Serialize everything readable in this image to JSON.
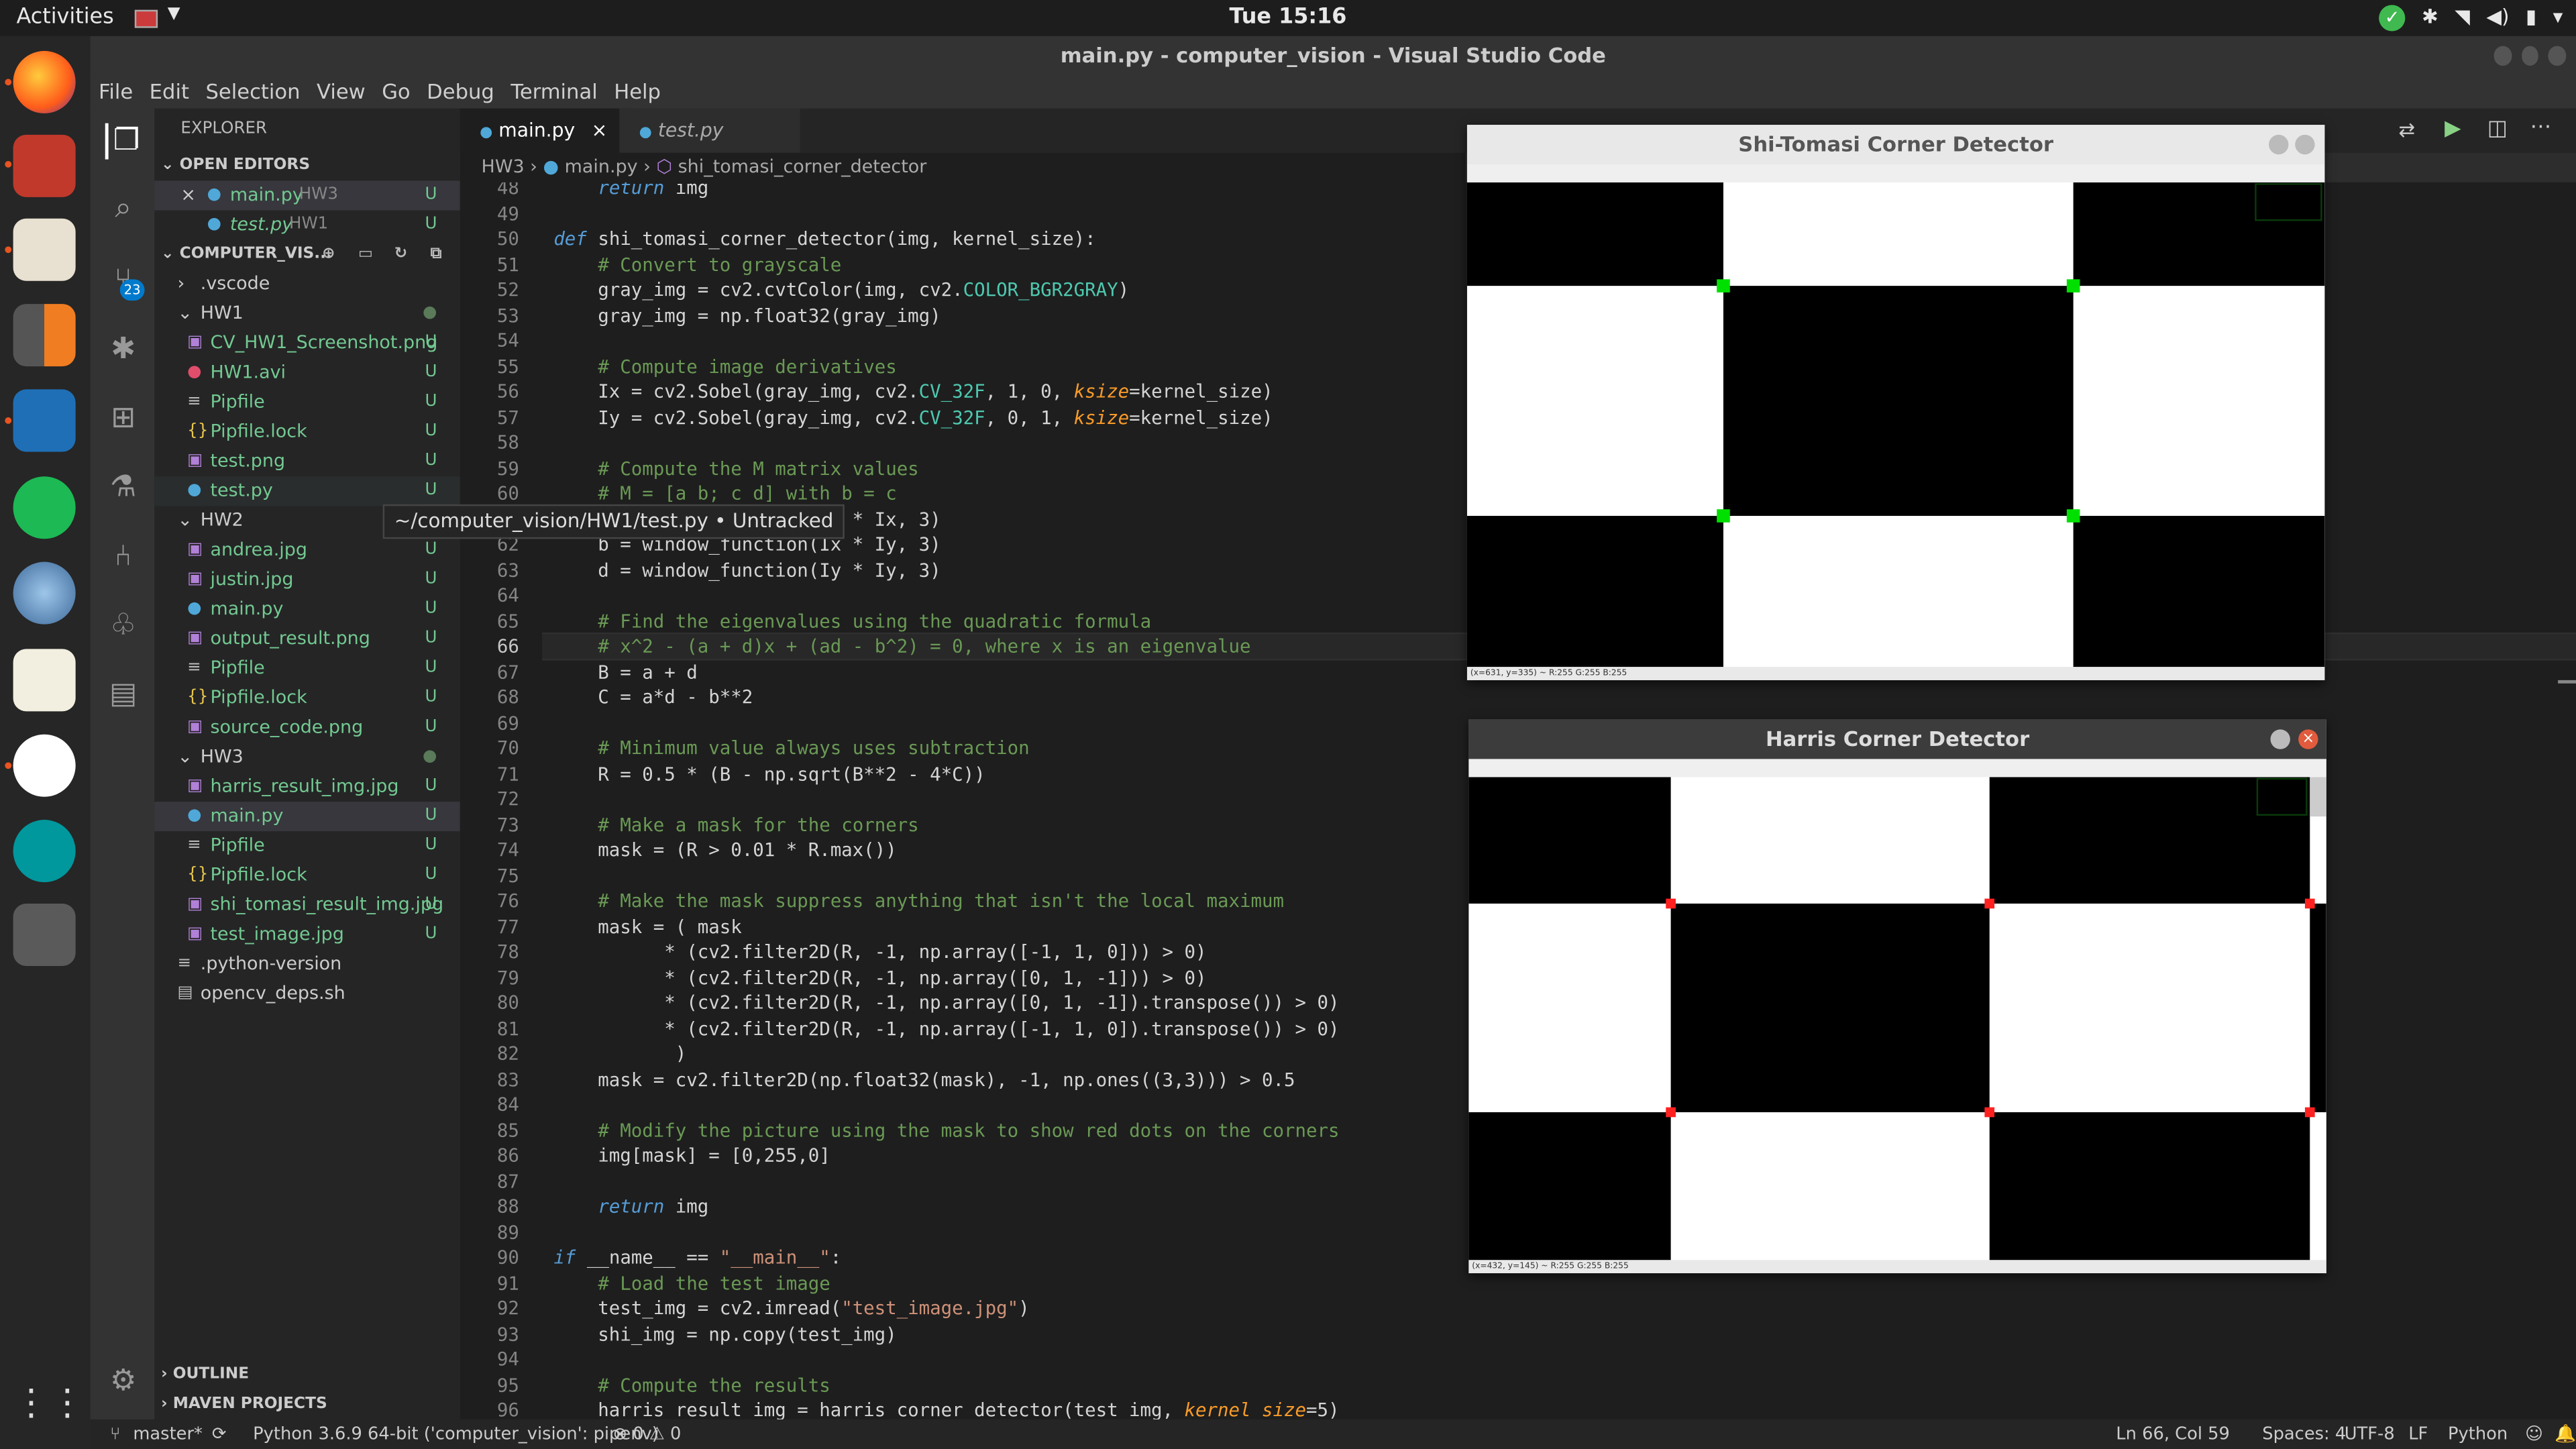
{
  "topbar": {
    "activities": "Activities",
    "clock": "Tue 15:16"
  },
  "window": {
    "title": "main.py - computer_vision - Visual Studio Code"
  },
  "menu": [
    "File",
    "Edit",
    "Selection",
    "View",
    "Go",
    "Debug",
    "Terminal",
    "Help"
  ],
  "activity": {
    "scm_badge": "23"
  },
  "sidebar": {
    "title": "EXPLORER",
    "open_editors": "OPEN EDITORS",
    "oe": [
      {
        "name": "main.py",
        "dir": "HW3",
        "status": "U"
      },
      {
        "name": "test.py",
        "dir": "HW1",
        "status": "U"
      }
    ],
    "folder": "COMPUTER_VIS...",
    "tree": [
      {
        "name": ".vscode",
        "status": ""
      },
      {
        "name": "HW1",
        "status": ""
      },
      {
        "name": "CV_HW1_Screenshot.png",
        "status": "U"
      },
      {
        "name": "HW1.avi",
        "status": "U"
      },
      {
        "name": "Pipfile",
        "status": "U"
      },
      {
        "name": "Pipfile.lock",
        "status": "U"
      },
      {
        "name": "test.png",
        "status": "U"
      },
      {
        "name": "test.py",
        "status": "U"
      },
      {
        "name": "HW2",
        "status": ""
      },
      {
        "name": "andrea.jpg",
        "status": "U"
      },
      {
        "name": "justin.jpg",
        "status": "U"
      },
      {
        "name": "main.py",
        "status": "U"
      },
      {
        "name": "output_result.png",
        "status": "U"
      },
      {
        "name": "Pipfile",
        "status": "U"
      },
      {
        "name": "Pipfile.lock",
        "status": "U"
      },
      {
        "name": "source_code.png",
        "status": "U"
      },
      {
        "name": "HW3",
        "status": ""
      },
      {
        "name": "harris_result_img.jpg",
        "status": "U"
      },
      {
        "name": "main.py",
        "status": "U"
      },
      {
        "name": "Pipfile",
        "status": "U"
      },
      {
        "name": "Pipfile.lock",
        "status": "U"
      },
      {
        "name": "shi_tomasi_result_img.jpg",
        "status": "U"
      },
      {
        "name": "test_image.jpg",
        "status": "U"
      },
      {
        "name": ".python-version",
        "status": ""
      },
      {
        "name": "opencv_deps.sh",
        "status": ""
      }
    ],
    "outline": "OUTLINE",
    "maven": "MAVEN PROJECTS"
  },
  "tabs": [
    {
      "label": "main.py"
    },
    {
      "label": "test.py"
    }
  ],
  "breadcrumb": {
    "folder": "HW3",
    "file": "main.py",
    "symbol": "shi_tomasi_corner_detector"
  },
  "tooltip": "~/computer_vision/HW1/test.py • Untracked",
  "editor": {
    "line_numbers": [
      "48",
      "49",
      "50",
      "51",
      "52",
      "53",
      "54",
      "55",
      "56",
      "57",
      "58",
      "59",
      "60",
      "61",
      "62",
      "63",
      "64",
      "65",
      "66",
      "67",
      "68",
      "69",
      "70",
      "71",
      "72",
      "73",
      "74",
      "75",
      "76",
      "77",
      "78",
      "79",
      "80",
      "81",
      "82",
      "83",
      "84",
      "85",
      "86",
      "87",
      "88",
      "89",
      "90",
      "91",
      "92",
      "93",
      "94",
      "95",
      "96"
    ],
    "lines": [
      "    return img",
      "",
      "def shi_tomasi_corner_detector(img, kernel_size):",
      "    # Convert to grayscale",
      "    gray_img = cv2.cvtColor(img, cv2.COLOR_BGR2GRAY)",
      "    gray_img = np.float32(gray_img)",
      "",
      "    # Compute image derivatives",
      "    Ix = cv2.Sobel(gray_img, cv2.CV_32F, 1, 0, ksize=kernel_size)",
      "    Iy = cv2.Sobel(gray_img, cv2.CV_32F, 0, 1, ksize=kernel_size)",
      "",
      "    # Compute the M matrix values",
      "    # M = [a b; c d] with b = c",
      "    a = window_function(Ix * Ix, 3)",
      "    b = window_function(Ix * Iy, 3)",
      "    d = window_function(Iy * Iy, 3)",
      "",
      "    # Find the eigenvalues using the quadratic formula",
      "    # x^2 - (a + d)x + (ad - b^2) = 0, where x is an eigenvalue",
      "    B = a + d",
      "    C = a*d - b**2",
      "",
      "    # Minimum value always uses subtraction",
      "    R = 0.5 * (B - np.sqrt(B**2 - 4*C))",
      "",
      "    # Make a mask for the corners",
      "    mask = (R > 0.01 * R.max())",
      "",
      "    # Make the mask suppress anything that isn't the local maximum",
      "    mask = ( mask",
      "          * (cv2.filter2D(R, -1, np.array([-1, 1, 0])) > 0)",
      "          * (cv2.filter2D(R, -1, np.array([0, 1, -1])) > 0)",
      "          * (cv2.filter2D(R, -1, np.array([0, 1, -1]).transpose()) > 0)",
      "          * (cv2.filter2D(R, -1, np.array([-1, 1, 0]).transpose()) > 0)",
      "           )",
      "    mask = cv2.filter2D(np.float32(mask), -1, np.ones((3,3))) > 0.5",
      "",
      "    # Modify the picture using the mask to show red dots on the corners",
      "    img[mask] = [0,255,0]",
      "",
      "    return img",
      "",
      "if __name__ == \"__main__\":",
      "    # Load the test image",
      "    test_img = cv2.imread(\"test_image.jpg\")",
      "    shi_img = np.copy(test_img)",
      "",
      "    # Compute the results",
      "    harris_result_img = harris_corner_detector(test_img, kernel_size=5)"
    ]
  },
  "cv_windows": {
    "shi": {
      "title": "Shi-Tomasi Corner Detector",
      "status": "(x=631, y=335) ~ R:255 G:255 B:255",
      "corner_color": "#00e000"
    },
    "harris": {
      "title": "Harris Corner Detector",
      "status": "(x=432, y=145) ~ R:255 G:255 B:255",
      "corner_color": "#ff2020"
    }
  },
  "statusbar": {
    "branch": "master*",
    "interpreter": "Python 3.6.9 64-bit ('computer_vision': pipenv)",
    "problems": "⊗ 0 ⚠ 0",
    "position": "Ln 66, Col 59",
    "spaces": "Spaces: 4",
    "encoding": "UTF-8",
    "eol": "LF",
    "language": "Python"
  }
}
